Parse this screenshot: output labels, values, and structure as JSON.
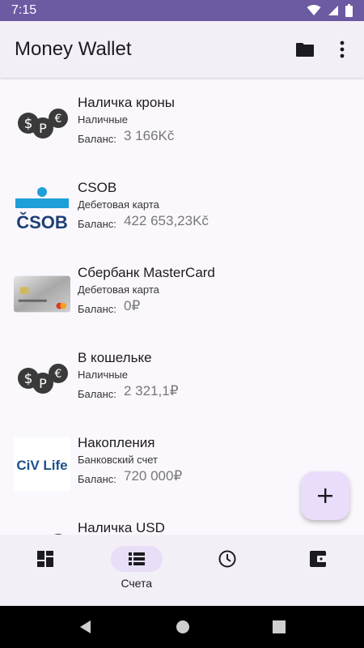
{
  "status_bar": {
    "time": "7:15"
  },
  "app_bar": {
    "title": "Money Wallet",
    "folder_icon": "folder-icon",
    "more_icon": "more-vert-icon"
  },
  "accounts": [
    {
      "name": "Наличка кроны",
      "type": "Наличные",
      "balance_label": "Баланс:",
      "balance": "3 166Kč",
      "icon": "cash-coins-icon"
    },
    {
      "name": "CSOB",
      "type": "Дебетовая карта",
      "balance_label": "Баланс:",
      "balance": "422 653,23Kč",
      "icon": "csob-logo",
      "logo_text": "ČSOB"
    },
    {
      "name": "Сбербанк MasterCard",
      "type": "Дебетовая карта",
      "balance_label": "Баланс:",
      "balance": "0₽",
      "icon": "sberbank-card-image"
    },
    {
      "name": "В кошельке",
      "type": "Наличные",
      "balance_label": "Баланс:",
      "balance": "2 321,1₽",
      "icon": "cash-coins-icon"
    },
    {
      "name": "Накопления",
      "type": "Банковский счет",
      "balance_label": "Баланс:",
      "balance": "720 000₽",
      "icon": "civ-life-logo",
      "logo_text": "CiV Life"
    },
    {
      "name": "Наличка USD",
      "type": "",
      "balance_label": "",
      "balance": "",
      "icon": "cash-coins-icon"
    }
  ],
  "fab": {
    "icon": "add-icon"
  },
  "bottom_nav": [
    {
      "label": "",
      "icon": "dashboard-icon",
      "active": false
    },
    {
      "label": "Счета",
      "icon": "list-icon",
      "active": true
    },
    {
      "label": "",
      "icon": "clock-icon",
      "active": false
    },
    {
      "label": "",
      "icon": "wallet-icon",
      "active": false
    }
  ],
  "colors": {
    "status_bar": "#6c5aa3",
    "app_bar": "#f3eff7",
    "fab": "#e9ddfb",
    "nav_active": "#e8def8"
  }
}
